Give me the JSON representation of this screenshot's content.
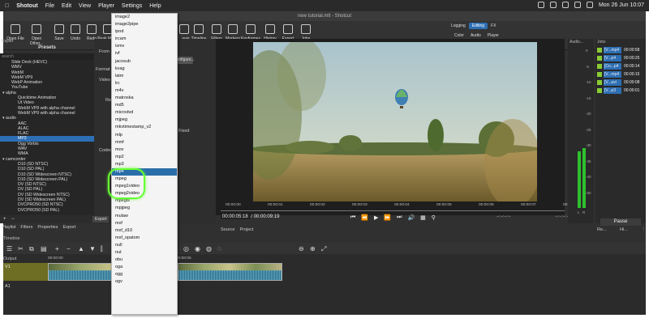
{
  "menubar": {
    "apple": "",
    "items": [
      "Shotout",
      "File",
      "Edit",
      "View",
      "Player",
      "Settings",
      "Help"
    ],
    "clock": "Mon 26 Jun  10:07"
  },
  "window": {
    "title": "new tutorial.mlt - Shotcut"
  },
  "toolbar": {
    "buttons": [
      "Open File",
      "Open Other...",
      "Save",
      "Undo",
      "Redo",
      "Peak Meter",
      "...ayer",
      "Timeline",
      "Filters",
      "Markers",
      "Keyframes",
      "History",
      "Export",
      "Jobs"
    ],
    "layouts_top": [
      "Logging",
      "Editing",
      "FX"
    ],
    "layouts_bottom": [
      "Color",
      "Audio",
      "Player"
    ],
    "selected_layout": "Editing"
  },
  "export_panel": {
    "tab": "Export",
    "presets_title": "Presets",
    "search_placeholder": "search",
    "presets": [
      {
        "label": "Slide Deck (HEVC)",
        "level": "l0"
      },
      {
        "label": "WMV",
        "level": "l0"
      },
      {
        "label": "WebM",
        "level": "l0"
      },
      {
        "label": "WebM VP9",
        "level": "l0"
      },
      {
        "label": "WebP Animation",
        "level": "l0"
      },
      {
        "label": "YouTube",
        "level": "l0"
      },
      {
        "label": "▾ alpha",
        "level": "cat"
      },
      {
        "label": "Quicktime Animation",
        "level": "l1"
      },
      {
        "label": "Ut Video",
        "level": "l1"
      },
      {
        "label": "WebM VP8 with alpha channel",
        "level": "l1"
      },
      {
        "label": "WebM VP9 with alpha channel",
        "level": "l1"
      },
      {
        "label": "▾ audio",
        "level": "cat"
      },
      {
        "label": "AAC",
        "level": "l1"
      },
      {
        "label": "ALAC",
        "level": "l1"
      },
      {
        "label": "FLAC",
        "level": "l1"
      },
      {
        "label": "MP3",
        "level": "l1",
        "selected": true
      },
      {
        "label": "Ogg Vorbis",
        "level": "l1"
      },
      {
        "label": "WAV",
        "level": "l1"
      },
      {
        "label": "WMA",
        "level": "l1"
      },
      {
        "label": "▾ camcorder",
        "level": "cat"
      },
      {
        "label": "D10 (SD NTSC)",
        "level": "l1"
      },
      {
        "label": "D10 (SD PAL)",
        "level": "l1"
      },
      {
        "label": "D10 (SD Widescreen NTSC)",
        "level": "l1"
      },
      {
        "label": "D10 (SD Widescreen PAL)",
        "level": "l1"
      },
      {
        "label": "DV (SD NTSC)",
        "level": "l1"
      },
      {
        "label": "DV (SD PAL)",
        "level": "l1"
      },
      {
        "label": "DV (SD Widescreen NTSC)",
        "level": "l1"
      },
      {
        "label": "DV (SD Widescreen PAL)",
        "level": "l1"
      },
      {
        "label": "DVCPRO50 (SD NTSC)",
        "level": "l1"
      },
      {
        "label": "DVCPRO50 (SD PAL)",
        "level": "l1"
      }
    ],
    "form_labels": {
      "from": "From",
      "format": "Format",
      "video": "Video",
      "resolution": "Re",
      "codec": "Codec",
      "configure": "Configure...",
      "fixed": "Fixed"
    },
    "add_button": "+",
    "remove_button": "−",
    "export_button": "Export"
  },
  "format_dropdown": {
    "options": [
      "image2",
      "image2pipe",
      "ipod",
      "ircam",
      "ismv",
      "ivf",
      "jacosub",
      "kvag",
      "latm",
      "lrc",
      "m4v",
      "matroska",
      "md5",
      "microdvd",
      "mjpeg",
      "mkvtimestamp_v2",
      "mlp",
      "mmf",
      "mov",
      "mp2",
      "mp3",
      "mp4",
      "mpeg",
      "mpeg1video",
      "mpeg2video",
      "mpegts",
      "mpjpeg",
      "mulaw",
      "mxf",
      "mxf_d10",
      "mxf_opatom",
      "null",
      "nut",
      "obu",
      "oga",
      "ogg",
      "ogv"
    ],
    "highlighted": "mp4"
  },
  "player": {
    "ruler_ticks": [
      "00:00:00",
      "00:00:01",
      "00:00:02",
      "00:00:03",
      "00:00:04",
      "00:00:05",
      "00:00:06",
      "00:00:07",
      "00:00:08"
    ],
    "current_time": "00:00:05:18",
    "total_time": "/ 00:00:09:19",
    "in_point": "--:--:--:--",
    "out_point": "--:--:--:--",
    "tabs": [
      "Source",
      "Project"
    ]
  },
  "audio_meter": {
    "title": "Audio...",
    "scale": [
      "0",
      "-5",
      "-10",
      "-15",
      "-20",
      "-25",
      "-30",
      "-35",
      "-40",
      "-50"
    ],
    "channels": [
      "L",
      "R"
    ],
    "levels": [
      0.58,
      0.62
    ]
  },
  "jobs": {
    "title": "Jobs",
    "items": [
      {
        "name": "[V...mp4",
        "time": "00:00:58"
      },
      {
        "name": "[V...p4",
        "time": "00:00:25"
      },
      {
        "name": "[Co...p4",
        "time": "00:00:14"
      },
      {
        "name": "[V...mp4",
        "time": "00:00:15"
      },
      {
        "name": "[V...avi",
        "time": "00:00:08"
      },
      {
        "name": "[V...p3",
        "time": "00:00:01"
      }
    ],
    "pause": "Pause",
    "bottom": [
      "Re...",
      "Hi...",
      "⋮"
    ]
  },
  "panel_tabs": [
    "Playlist",
    "Filters",
    "Properties",
    "Export"
  ],
  "timeline": {
    "title": "Timeline",
    "output": "Output",
    "track_v1": "V1",
    "track_a1": "A1",
    "ruler": [
      "00:00:00",
      "00:00:05"
    ]
  },
  "colors": {
    "accent": "#2d6fb4",
    "highlight_ring": "#66ff33",
    "meter": "#2ec12e"
  }
}
